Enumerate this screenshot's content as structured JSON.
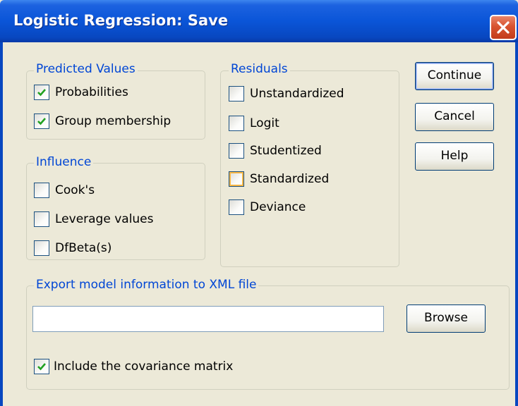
{
  "window": {
    "title": "Logistic Regression: Save"
  },
  "predicted_values": {
    "legend": "Predicted Values",
    "items": [
      {
        "label": "Probabilities",
        "checked": true
      },
      {
        "label": "Group membership",
        "checked": true
      }
    ]
  },
  "influence": {
    "legend": "Influence",
    "items": [
      {
        "label": "Cook's",
        "checked": false
      },
      {
        "label": "Leverage values",
        "checked": false
      },
      {
        "label": "DfBeta(s)",
        "checked": false
      }
    ]
  },
  "residuals": {
    "legend": "Residuals",
    "items": [
      {
        "label": "Unstandardized",
        "checked": false
      },
      {
        "label": "Logit",
        "checked": false
      },
      {
        "label": "Studentized",
        "checked": false
      },
      {
        "label": "Standardized",
        "checked": false
      },
      {
        "label": "Deviance",
        "checked": false
      }
    ]
  },
  "buttons": {
    "continue": "Continue",
    "cancel": "Cancel",
    "help": "Help",
    "browse": "Browse"
  },
  "export": {
    "legend": "Export model information to XML file",
    "file_value": "",
    "covariance_label": "Include the covariance matrix",
    "covariance_checked": true
  },
  "colors": {
    "accent": "#0046d5",
    "title_bar": "#0a55d8",
    "close_button": "#d8532f"
  }
}
